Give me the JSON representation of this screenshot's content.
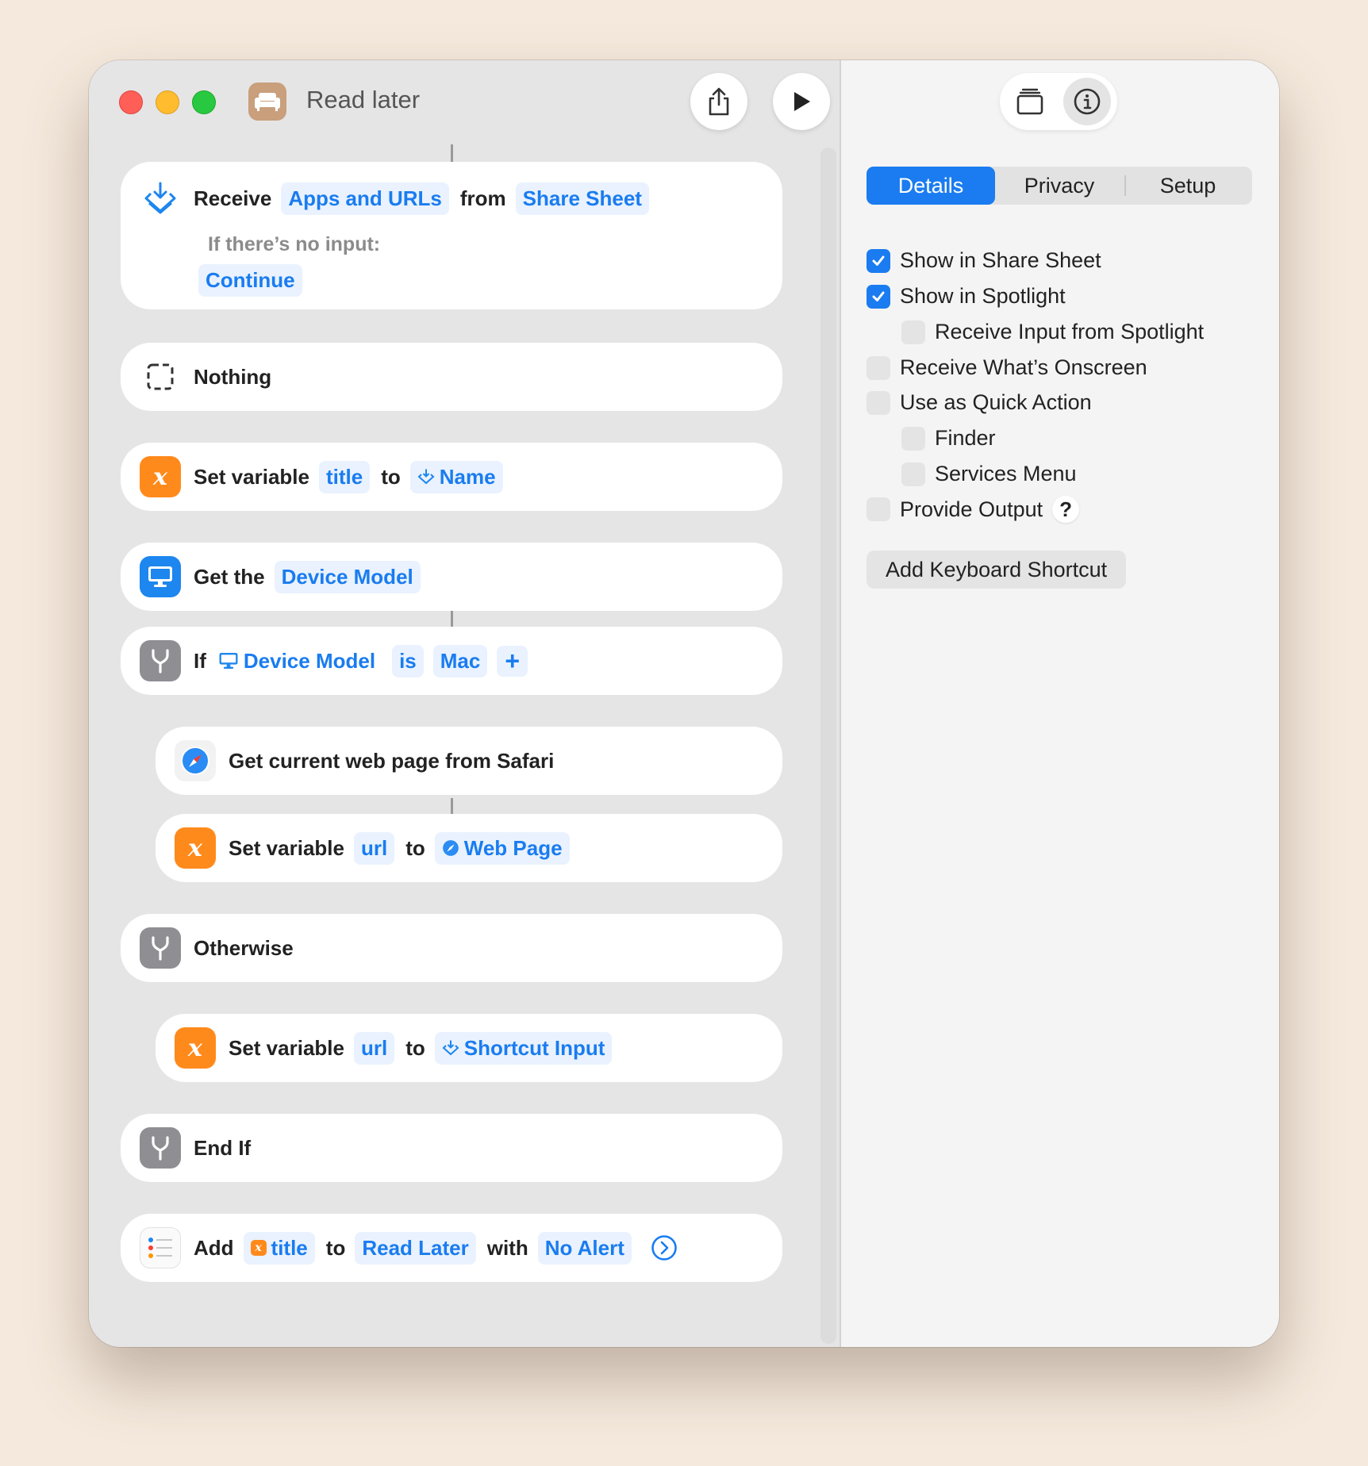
{
  "window": {
    "title": "Read later"
  },
  "actions": {
    "receive": {
      "verb": "Receive",
      "input_types": "Apps and URLs",
      "from_word": "from",
      "source": "Share Sheet",
      "no_input_label": "If there’s no input:",
      "no_input_action": "Continue"
    },
    "nothing": {
      "label": "Nothing"
    },
    "set_title": {
      "verb": "Set variable",
      "variable": "title",
      "to_word": "to",
      "value": "Name"
    },
    "get_device": {
      "verb": "Get the",
      "value": "Device Model"
    },
    "if_block": {
      "verb": "If",
      "subject": "Device Model",
      "condition": "is",
      "value": "Mac",
      "add": "+"
    },
    "get_web_page": {
      "label": "Get current web page from Safari"
    },
    "set_url_web": {
      "verb": "Set variable",
      "variable": "url",
      "to_word": "to",
      "value": "Web Page"
    },
    "otherwise": {
      "label": "Otherwise"
    },
    "set_url_input": {
      "verb": "Set variable",
      "variable": "url",
      "to_word": "to",
      "value": "Shortcut Input"
    },
    "end_if": {
      "label": "End If"
    },
    "add_reminder": {
      "verb": "Add",
      "item": "title",
      "to_word": "to",
      "list": "Read Later",
      "with_word": "with",
      "alert": "No Alert"
    }
  },
  "details_panel": {
    "tabs": [
      {
        "label": "Details",
        "active": true
      },
      {
        "label": "Privacy",
        "active": false
      },
      {
        "label": "Setup",
        "active": false
      }
    ],
    "options": [
      {
        "label": "Show in Share Sheet",
        "checked": true
      },
      {
        "label": "Show in Spotlight",
        "checked": true
      },
      {
        "label": "Receive Input from Spotlight",
        "checked": false
      },
      {
        "label": "Receive What’s Onscreen",
        "checked": false
      },
      {
        "label": "Use as Quick Action",
        "checked": false
      },
      {
        "label": "Finder",
        "checked": false
      },
      {
        "label": "Services Menu",
        "checked": false
      },
      {
        "label": "Provide Output",
        "checked": false
      }
    ],
    "help_glyph": "?",
    "keyboard_shortcut_button": "Add Keyboard Shortcut"
  },
  "colors": {
    "accent": "#1a7cf0",
    "token_bg": "#e9f2fe",
    "variable_orange": "#ff8a1c",
    "background": "#f5e9dd"
  }
}
